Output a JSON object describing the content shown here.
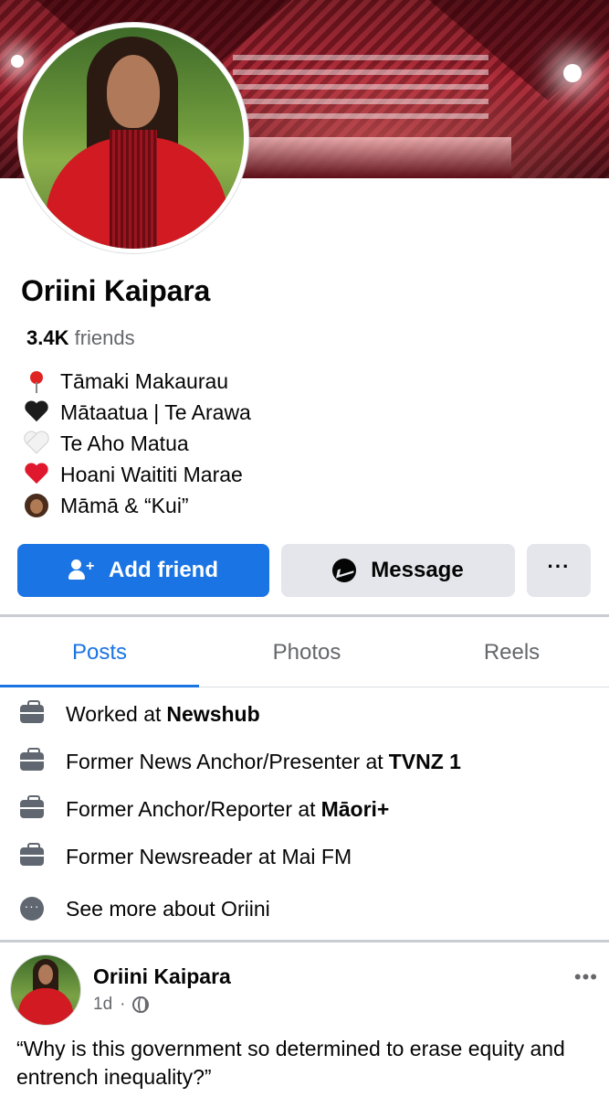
{
  "profile": {
    "name": "Oriini Kaipara",
    "friends_count": "3.4K",
    "friends_label": "friends",
    "bio": [
      {
        "icon": "pin-icon",
        "text": "Tāmaki Makaurau"
      },
      {
        "icon": "black-heart-icon",
        "text": "Mātaatua | Te Arawa"
      },
      {
        "icon": "white-heart-icon",
        "text": "Te Aho Matua"
      },
      {
        "icon": "red-heart-icon",
        "text": "Hoani Waititi Marae"
      },
      {
        "icon": "woman-emoji-icon",
        "text": "Māmā & “Kui”"
      }
    ]
  },
  "actions": {
    "add_friend": "Add friend",
    "message": "Message",
    "more": "···"
  },
  "tabs": [
    {
      "label": "Posts",
      "active": true
    },
    {
      "label": "Photos",
      "active": false
    },
    {
      "label": "Reels",
      "active": false
    }
  ],
  "work": [
    {
      "prefix": "Worked at",
      "org": "Newshub"
    },
    {
      "prefix": "Former News Anchor/Presenter at",
      "org": "TVNZ 1"
    },
    {
      "prefix": "Former Anchor/Reporter at",
      "org": "Māori+"
    },
    {
      "prefix": "Former Newsreader at Mai FM",
      "org": ""
    }
  ],
  "see_more": "See more about Oriini",
  "post": {
    "author": "Oriini Kaipara",
    "time": "1d",
    "separator": "·",
    "more": "•••",
    "text": "“Why is this government so determined to erase equity and entrench inequality?”"
  },
  "colors": {
    "accent": "#1b74e4",
    "secondary_button": "#e4e6eb",
    "muted_text": "#65676b"
  }
}
